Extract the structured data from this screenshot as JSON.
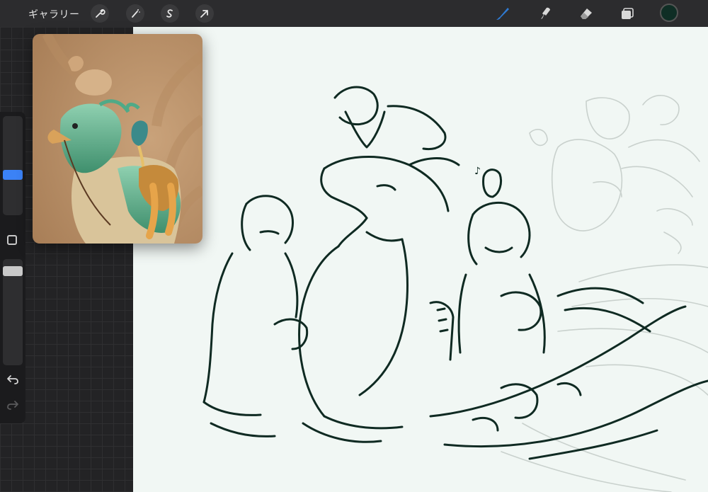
{
  "toolbar": {
    "gallery_label": "ギャラリー",
    "actions_icon": "wrench-icon",
    "adjustments_icon": "magic-wand-icon",
    "selection_icon": "selection-s-icon",
    "transform_icon": "arrow-cursor-icon",
    "brush_icon": "brush-icon",
    "smudge_icon": "smudge-icon",
    "eraser_icon": "eraser-icon",
    "layers_icon": "layers-icon",
    "active_tool_color": "#2f7bd4",
    "current_color": "#0f2e25"
  },
  "sidebar": {
    "brush_size_icon": "size-slider",
    "opacity_icon": "opacity-slider",
    "modify_icon": "square-modify-icon",
    "undo_icon": "undo-icon",
    "redo_icon": "redo-icon",
    "thumb_color_size": "#3b82f6",
    "thumb_color_opacity": "#c9c9c9"
  },
  "reference": {
    "window_label": "reference-image",
    "icon": "chocobo-reference-image"
  },
  "canvas": {
    "background": "#f1f7f4",
    "ink_color": "#0f2a22",
    "sketch_color": "#c9d1cd"
  }
}
